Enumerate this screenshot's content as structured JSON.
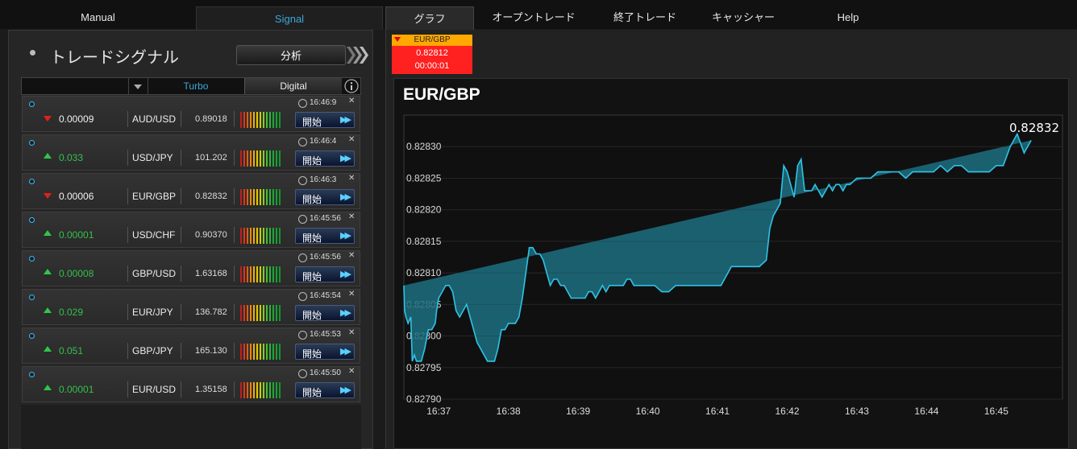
{
  "nav": {
    "manual": "Manual",
    "signal": "Signal",
    "graph": "グラフ",
    "open_trade": "オープントレード",
    "closed_trade": "終了トレード",
    "cashier": "キャッシャー",
    "help": "Help"
  },
  "left": {
    "title": "トレードシグナル",
    "analyze_label": "分析",
    "filter": {
      "dropdown_value": "",
      "turbo": "Turbo",
      "digital": "Digital"
    },
    "start_label": "開始",
    "signals": [
      {
        "direction": "down",
        "change": "0.00009",
        "pair": "AUD/USD",
        "price": "0.89018",
        "time": "16:46:9"
      },
      {
        "direction": "up",
        "change": "0.033",
        "pair": "USD/JPY",
        "price": "101.202",
        "time": "16:46:4"
      },
      {
        "direction": "down",
        "change": "0.00006",
        "pair": "EUR/GBP",
        "price": "0.82832",
        "time": "16:46:3"
      },
      {
        "direction": "up",
        "change": "0.00001",
        "pair": "USD/CHF",
        "price": "0.90370",
        "time": "16:45:56"
      },
      {
        "direction": "up",
        "change": "0.00008",
        "pair": "GBP/USD",
        "price": "1.63168",
        "time": "16:45:56"
      },
      {
        "direction": "up",
        "change": "0.029",
        "pair": "EUR/JPY",
        "price": "136.782",
        "time": "16:45:54"
      },
      {
        "direction": "up",
        "change": "0.051",
        "pair": "GBP/JPY",
        "price": "165.130",
        "time": "16:45:53"
      },
      {
        "direction": "up",
        "change": "0.00001",
        "pair": "EUR/USD",
        "price": "1.35158",
        "time": "16:45:50"
      }
    ]
  },
  "ticker": {
    "pair": "EUR/GBP",
    "price": "0.82812",
    "countdown": "00:00:01",
    "color": "#ff2020",
    "header_color": "#ffa800"
  },
  "chart_data": {
    "type": "area",
    "title": "EUR/GBP",
    "last_label": "0.82832",
    "ylim": [
      0.8279,
      0.82835
    ],
    "yticks": [
      "0.82790",
      "0.82795",
      "0.82800",
      "0.82805",
      "0.82810",
      "0.82815",
      "0.82820",
      "0.82825",
      "0.82830"
    ],
    "xticks": [
      "16:37",
      "16:38",
      "16:39",
      "16:40",
      "16:41",
      "16:42",
      "16:43",
      "16:44",
      "16:45"
    ],
    "grid": true,
    "line_color": "#2fc3e6",
    "x_minutes": [
      36.5,
      36.51,
      36.53,
      36.56,
      36.6,
      36.62,
      36.65,
      36.68,
      36.72,
      36.75,
      36.8,
      36.85,
      36.9,
      36.95,
      36.97,
      37.0,
      37.05,
      37.1,
      37.15,
      37.2,
      37.25,
      37.3,
      37.35,
      37.4,
      37.45,
      37.5,
      37.55,
      37.6,
      37.65,
      37.7,
      37.75,
      37.8,
      37.85,
      37.9,
      37.95,
      38.0,
      38.05,
      38.1,
      38.15,
      38.2,
      38.25,
      38.3,
      38.35,
      38.4,
      38.45,
      38.5,
      38.55,
      38.6,
      38.65,
      38.7,
      38.75,
      38.8,
      38.85,
      38.9,
      38.95,
      39.0,
      39.05,
      39.1,
      39.15,
      39.2,
      39.25,
      39.3,
      39.35,
      39.4,
      39.45,
      39.5,
      39.55,
      39.6,
      39.65,
      39.7,
      39.75,
      39.8,
      39.85,
      39.9,
      39.95,
      40.0,
      40.1,
      40.2,
      40.3,
      40.4,
      40.5,
      40.55,
      40.6,
      40.65,
      40.7,
      40.75,
      40.8,
      40.85,
      40.9,
      40.95,
      41.0,
      41.05,
      41.1,
      41.15,
      41.2,
      41.3,
      41.4,
      41.5,
      41.6,
      41.7,
      41.75,
      41.8,
      41.85,
      41.9,
      41.95,
      42.0,
      42.05,
      42.1,
      42.15,
      42.2,
      42.25,
      42.3,
      42.35,
      42.4,
      42.45,
      42.5,
      42.55,
      42.6,
      42.65,
      42.7,
      42.75,
      42.8,
      42.85,
      42.9,
      43.0,
      43.1,
      43.2,
      43.3,
      43.4,
      43.5,
      43.6,
      43.7,
      43.8,
      43.9,
      44.0,
      44.1,
      44.2,
      44.3,
      44.4,
      44.5,
      44.6,
      44.7,
      44.8,
      44.9,
      45.0,
      45.1,
      45.2,
      45.3,
      45.4,
      45.5,
      45.6,
      45.7,
      45.8,
      45.9
    ],
    "values": [
      0.82808,
      0.82804,
      0.82803,
      0.82802,
      0.82803,
      0.82796,
      0.82797,
      0.82796,
      0.82796,
      0.82796,
      0.82798,
      0.82801,
      0.82801,
      0.82802,
      0.82804,
      0.82806,
      0.82807,
      0.82808,
      0.82808,
      0.82807,
      0.82804,
      0.82803,
      0.82804,
      0.82805,
      0.82803,
      0.82801,
      0.82799,
      0.82798,
      0.82797,
      0.82796,
      0.82796,
      0.82796,
      0.82798,
      0.82801,
      0.82801,
      0.82802,
      0.82802,
      0.82802,
      0.82803,
      0.82806,
      0.8281,
      0.82814,
      0.82814,
      0.82813,
      0.82813,
      0.82812,
      0.8281,
      0.82808,
      0.82809,
      0.82809,
      0.82808,
      0.82808,
      0.82807,
      0.82806,
      0.82806,
      0.82806,
      0.82806,
      0.82806,
      0.82807,
      0.82807,
      0.82806,
      0.82807,
      0.82808,
      0.82807,
      0.82808,
      0.82808,
      0.82808,
      0.82808,
      0.82808,
      0.82809,
      0.82809,
      0.82808,
      0.82808,
      0.82808,
      0.82808,
      0.82808,
      0.82808,
      0.82807,
      0.82807,
      0.82808,
      0.82808,
      0.82808,
      0.82808,
      0.82808,
      0.82808,
      0.82808,
      0.82808,
      0.82808,
      0.82808,
      0.82808,
      0.82808,
      0.82808,
      0.82809,
      0.8281,
      0.82811,
      0.82811,
      0.82811,
      0.82811,
      0.82811,
      0.82812,
      0.82817,
      0.82819,
      0.8282,
      0.82821,
      0.82827,
      0.82826,
      0.82824,
      0.82822,
      0.82827,
      0.82828,
      0.82823,
      0.82823,
      0.82823,
      0.82824,
      0.82823,
      0.82822,
      0.82823,
      0.82824,
      0.82823,
      0.82824,
      0.82824,
      0.82823,
      0.82824,
      0.82824,
      0.82825,
      0.82825,
      0.82825,
      0.82826,
      0.82826,
      0.82826,
      0.82826,
      0.82825,
      0.82826,
      0.82826,
      0.82826,
      0.82826,
      0.82827,
      0.82826,
      0.82827,
      0.82827,
      0.82826,
      0.82826,
      0.82826,
      0.82826,
      0.82827,
      0.82827,
      0.8283,
      0.82832,
      0.82829,
      0.82831
    ]
  }
}
